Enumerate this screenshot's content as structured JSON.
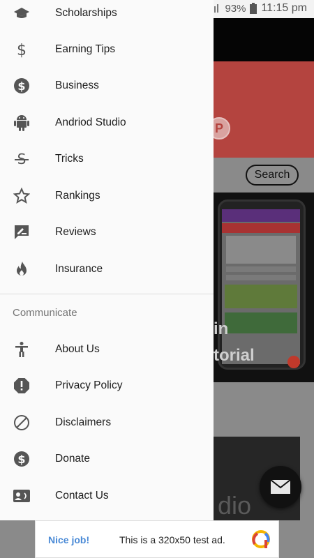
{
  "status_bar": {
    "battery": "93%",
    "time": "11:15 pm",
    "signal": "4G"
  },
  "drawer": {
    "items": [
      {
        "label": "Scholarships",
        "icon": "graduation-cap-icon"
      },
      {
        "label": "Earning Tips",
        "icon": "dollar-sign-icon"
      },
      {
        "label": "Business",
        "icon": "dollar-circle-icon"
      },
      {
        "label": "Andriod Studio",
        "icon": "android-icon"
      },
      {
        "label": "Tricks",
        "icon": "strikethrough-icon"
      },
      {
        "label": "Rankings",
        "icon": "star-outline-icon"
      },
      {
        "label": "Reviews",
        "icon": "rate-review-icon"
      },
      {
        "label": "Insurance",
        "icon": "whatshot-icon"
      }
    ],
    "section_header": "Communicate",
    "communicate_items": [
      {
        "label": "About Us",
        "icon": "accessibility-icon"
      },
      {
        "label": "Privacy Policy",
        "icon": "alert-octagon-icon"
      },
      {
        "label": "Disclaimers",
        "icon": "block-icon"
      },
      {
        "label": "Donate",
        "icon": "dollar-circle-icon"
      },
      {
        "label": "Contact Us",
        "icon": "contact-card-icon"
      }
    ]
  },
  "background": {
    "search_label": "Search",
    "overlay_line1": "in",
    "overlay_line2": "torial",
    "bottom_text": "dio"
  },
  "ad": {
    "left_text": "Nice job!",
    "main_text": "This is a 320x50 test ad."
  },
  "colors": {
    "accent_red": "#b4443f",
    "drawer_bg": "#fafafa",
    "ad_link": "#4a8ad6"
  }
}
